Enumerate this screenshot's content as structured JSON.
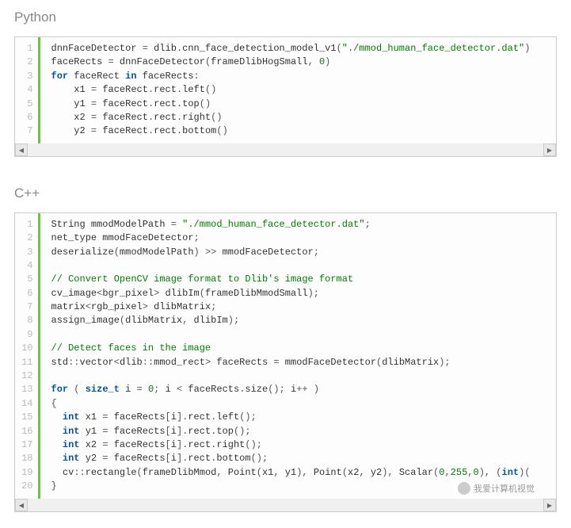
{
  "sections": [
    {
      "title": "Python",
      "lines": [
        [
          {
            "t": "dnnFaceDetector ",
            "c": ""
          },
          {
            "t": "=",
            "c": "op"
          },
          {
            "t": " dlib",
            "c": ""
          },
          {
            "t": ".",
            "c": "op"
          },
          {
            "t": "cnn_face_detection_model_v1",
            "c": ""
          },
          {
            "t": "(",
            "c": "op"
          },
          {
            "t": "\"./mmod_human_face_detector.dat\"",
            "c": "str"
          },
          {
            "t": ")",
            "c": "op"
          }
        ],
        [
          {
            "t": "faceRects ",
            "c": ""
          },
          {
            "t": "=",
            "c": "op"
          },
          {
            "t": " dnnFaceDetector",
            "c": ""
          },
          {
            "t": "(",
            "c": "op"
          },
          {
            "t": "frameDlibHogSmall",
            "c": ""
          },
          {
            "t": ", ",
            "c": "op"
          },
          {
            "t": "0",
            "c": "num"
          },
          {
            "t": ")",
            "c": "op"
          }
        ],
        [
          {
            "t": "for",
            "c": "kw"
          },
          {
            "t": " faceRect ",
            "c": ""
          },
          {
            "t": "in",
            "c": "kw"
          },
          {
            "t": " faceRects",
            "c": ""
          },
          {
            "t": ":",
            "c": "op"
          }
        ],
        [
          {
            "t": "    x1 ",
            "c": ""
          },
          {
            "t": "=",
            "c": "op"
          },
          {
            "t": " faceRect",
            "c": ""
          },
          {
            "t": ".",
            "c": "op"
          },
          {
            "t": "rect",
            "c": ""
          },
          {
            "t": ".",
            "c": "op"
          },
          {
            "t": "left",
            "c": ""
          },
          {
            "t": "()",
            "c": "op"
          }
        ],
        [
          {
            "t": "    y1 ",
            "c": ""
          },
          {
            "t": "=",
            "c": "op"
          },
          {
            "t": " faceRect",
            "c": ""
          },
          {
            "t": ".",
            "c": "op"
          },
          {
            "t": "rect",
            "c": ""
          },
          {
            "t": ".",
            "c": "op"
          },
          {
            "t": "top",
            "c": ""
          },
          {
            "t": "()",
            "c": "op"
          }
        ],
        [
          {
            "t": "    x2 ",
            "c": ""
          },
          {
            "t": "=",
            "c": "op"
          },
          {
            "t": " faceRect",
            "c": ""
          },
          {
            "t": ".",
            "c": "op"
          },
          {
            "t": "rect",
            "c": ""
          },
          {
            "t": ".",
            "c": "op"
          },
          {
            "t": "right",
            "c": ""
          },
          {
            "t": "()",
            "c": "op"
          }
        ],
        [
          {
            "t": "    y2 ",
            "c": ""
          },
          {
            "t": "=",
            "c": "op"
          },
          {
            "t": " faceRect",
            "c": ""
          },
          {
            "t": ".",
            "c": "op"
          },
          {
            "t": "rect",
            "c": ""
          },
          {
            "t": ".",
            "c": "op"
          },
          {
            "t": "bottom",
            "c": ""
          },
          {
            "t": "()",
            "c": "op"
          }
        ]
      ]
    },
    {
      "title": "C++",
      "lines": [
        [
          {
            "t": "String mmodModelPath ",
            "c": ""
          },
          {
            "t": "=",
            "c": "op"
          },
          {
            "t": " ",
            "c": ""
          },
          {
            "t": "\"./mmod_human_face_detector.dat\"",
            "c": "str"
          },
          {
            "t": ";",
            "c": "op"
          }
        ],
        [
          {
            "t": "net_type mmodFaceDetector",
            "c": ""
          },
          {
            "t": ";",
            "c": "op"
          }
        ],
        [
          {
            "t": "deserialize",
            "c": ""
          },
          {
            "t": "(",
            "c": "op"
          },
          {
            "t": "mmodModelPath",
            "c": ""
          },
          {
            "t": ") >> ",
            "c": "op"
          },
          {
            "t": "mmodFaceDetector",
            "c": ""
          },
          {
            "t": ";",
            "c": "op"
          }
        ],
        [
          {
            "t": "",
            "c": ""
          }
        ],
        [
          {
            "t": "// Convert OpenCV image format to Dlib's image format",
            "c": "com"
          }
        ],
        [
          {
            "t": "cv_image",
            "c": ""
          },
          {
            "t": "<",
            "c": "op"
          },
          {
            "t": "bgr_pixel",
            "c": ""
          },
          {
            "t": "> ",
            "c": "op"
          },
          {
            "t": "dlibIm",
            "c": ""
          },
          {
            "t": "(",
            "c": "op"
          },
          {
            "t": "frameDlibMmodSmall",
            "c": ""
          },
          {
            "t": ");",
            "c": "op"
          }
        ],
        [
          {
            "t": "matrix",
            "c": ""
          },
          {
            "t": "<",
            "c": "op"
          },
          {
            "t": "rgb_pixel",
            "c": ""
          },
          {
            "t": "> ",
            "c": "op"
          },
          {
            "t": "dlibMatrix",
            "c": ""
          },
          {
            "t": ";",
            "c": "op"
          }
        ],
        [
          {
            "t": "assign_image",
            "c": ""
          },
          {
            "t": "(",
            "c": "op"
          },
          {
            "t": "dlibMatrix",
            "c": ""
          },
          {
            "t": ", ",
            "c": "op"
          },
          {
            "t": "dlibIm",
            "c": ""
          },
          {
            "t": ");",
            "c": "op"
          }
        ],
        [
          {
            "t": "",
            "c": ""
          }
        ],
        [
          {
            "t": "// Detect faces in the image",
            "c": "com"
          }
        ],
        [
          {
            "t": "std",
            "c": ""
          },
          {
            "t": "::",
            "c": "op"
          },
          {
            "t": "vector",
            "c": ""
          },
          {
            "t": "<",
            "c": "op"
          },
          {
            "t": "dlib",
            "c": ""
          },
          {
            "t": "::",
            "c": "op"
          },
          {
            "t": "mmod_rect",
            "c": ""
          },
          {
            "t": "> ",
            "c": "op"
          },
          {
            "t": "faceRects ",
            "c": ""
          },
          {
            "t": "= ",
            "c": "op"
          },
          {
            "t": "mmodFaceDetector",
            "c": ""
          },
          {
            "t": "(",
            "c": "op"
          },
          {
            "t": "dlibMatrix",
            "c": ""
          },
          {
            "t": ");",
            "c": "op"
          }
        ],
        [
          {
            "t": "",
            "c": ""
          }
        ],
        [
          {
            "t": "for",
            "c": "kw"
          },
          {
            "t": " ( ",
            "c": "op"
          },
          {
            "t": "size_t",
            "c": "kw"
          },
          {
            "t": " i ",
            "c": ""
          },
          {
            "t": "= ",
            "c": "op"
          },
          {
            "t": "0",
            "c": "num"
          },
          {
            "t": "; ",
            "c": "op"
          },
          {
            "t": "i ",
            "c": ""
          },
          {
            "t": "< ",
            "c": "op"
          },
          {
            "t": "faceRects",
            "c": ""
          },
          {
            "t": ".",
            "c": "op"
          },
          {
            "t": "size",
            "c": ""
          },
          {
            "t": "(); ",
            "c": "op"
          },
          {
            "t": "i",
            "c": ""
          },
          {
            "t": "++ )",
            "c": "op"
          }
        ],
        [
          {
            "t": "{",
            "c": "op"
          }
        ],
        [
          {
            "t": "  ",
            "c": ""
          },
          {
            "t": "int",
            "c": "kw"
          },
          {
            "t": " x1 ",
            "c": ""
          },
          {
            "t": "= ",
            "c": "op"
          },
          {
            "t": "faceRects",
            "c": ""
          },
          {
            "t": "[",
            "c": "op"
          },
          {
            "t": "i",
            "c": ""
          },
          {
            "t": "].",
            "c": "op"
          },
          {
            "t": "rect",
            "c": ""
          },
          {
            "t": ".",
            "c": "op"
          },
          {
            "t": "left",
            "c": ""
          },
          {
            "t": "();",
            "c": "op"
          }
        ],
        [
          {
            "t": "  ",
            "c": ""
          },
          {
            "t": "int",
            "c": "kw"
          },
          {
            "t": " y1 ",
            "c": ""
          },
          {
            "t": "= ",
            "c": "op"
          },
          {
            "t": "faceRects",
            "c": ""
          },
          {
            "t": "[",
            "c": "op"
          },
          {
            "t": "i",
            "c": ""
          },
          {
            "t": "].",
            "c": "op"
          },
          {
            "t": "rect",
            "c": ""
          },
          {
            "t": ".",
            "c": "op"
          },
          {
            "t": "top",
            "c": ""
          },
          {
            "t": "();",
            "c": "op"
          }
        ],
        [
          {
            "t": "  ",
            "c": ""
          },
          {
            "t": "int",
            "c": "kw"
          },
          {
            "t": " x2 ",
            "c": ""
          },
          {
            "t": "= ",
            "c": "op"
          },
          {
            "t": "faceRects",
            "c": ""
          },
          {
            "t": "[",
            "c": "op"
          },
          {
            "t": "i",
            "c": ""
          },
          {
            "t": "].",
            "c": "op"
          },
          {
            "t": "rect",
            "c": ""
          },
          {
            "t": ".",
            "c": "op"
          },
          {
            "t": "right",
            "c": ""
          },
          {
            "t": "();",
            "c": "op"
          }
        ],
        [
          {
            "t": "  ",
            "c": ""
          },
          {
            "t": "int",
            "c": "kw"
          },
          {
            "t": " y2 ",
            "c": ""
          },
          {
            "t": "= ",
            "c": "op"
          },
          {
            "t": "faceRects",
            "c": ""
          },
          {
            "t": "[",
            "c": "op"
          },
          {
            "t": "i",
            "c": ""
          },
          {
            "t": "].",
            "c": "op"
          },
          {
            "t": "rect",
            "c": ""
          },
          {
            "t": ".",
            "c": "op"
          },
          {
            "t": "bottom",
            "c": ""
          },
          {
            "t": "();",
            "c": "op"
          }
        ],
        [
          {
            "t": "  cv",
            "c": ""
          },
          {
            "t": "::",
            "c": "op"
          },
          {
            "t": "rectangle",
            "c": ""
          },
          {
            "t": "(",
            "c": "op"
          },
          {
            "t": "frameDlibMmod",
            "c": ""
          },
          {
            "t": ", ",
            "c": "op"
          },
          {
            "t": "Point",
            "c": ""
          },
          {
            "t": "(",
            "c": "op"
          },
          {
            "t": "x1",
            "c": ""
          },
          {
            "t": ", ",
            "c": "op"
          },
          {
            "t": "y1",
            "c": ""
          },
          {
            "t": "), ",
            "c": "op"
          },
          {
            "t": "Point",
            "c": ""
          },
          {
            "t": "(",
            "c": "op"
          },
          {
            "t": "x2",
            "c": ""
          },
          {
            "t": ", ",
            "c": "op"
          },
          {
            "t": "y2",
            "c": ""
          },
          {
            "t": "), ",
            "c": "op"
          },
          {
            "t": "Scalar",
            "c": ""
          },
          {
            "t": "(",
            "c": "op"
          },
          {
            "t": "0",
            "c": "num"
          },
          {
            "t": ",",
            "c": "op"
          },
          {
            "t": "255",
            "c": "num"
          },
          {
            "t": ",",
            "c": "op"
          },
          {
            "t": "0",
            "c": "num"
          },
          {
            "t": "), (",
            "c": "op"
          },
          {
            "t": "int",
            "c": "kw"
          },
          {
            "t": ")(",
            "c": "op"
          }
        ],
        [
          {
            "t": "}",
            "c": "op"
          }
        ]
      ]
    }
  ],
  "watermark": {
    "text": "我爱计算机视觉"
  },
  "scroll": {
    "left": "◀",
    "right": "▶"
  }
}
